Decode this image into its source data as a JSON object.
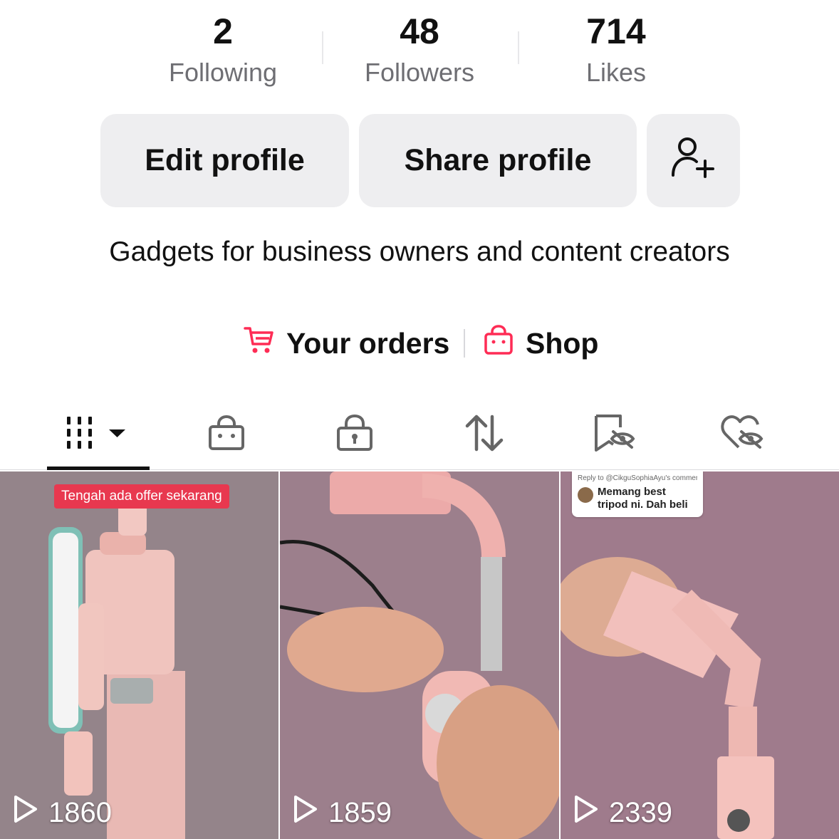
{
  "stats": [
    {
      "value": "2",
      "label": "Following"
    },
    {
      "value": "48",
      "label": "Followers"
    },
    {
      "value": "714",
      "label": "Likes"
    }
  ],
  "actions": {
    "edit_label": "Edit profile",
    "share_label": "Share profile",
    "add_friend_icon": "person-plus-icon"
  },
  "bio": "Gadgets for business owners and content creators",
  "links": {
    "orders_label": "Your orders",
    "orders_icon": "cart-icon",
    "shop_label": "Shop",
    "shop_icon": "shopping-bag-icon",
    "accent_color": "#fe2c55"
  },
  "tabs": [
    {
      "icon": "grid-icon",
      "active": true
    },
    {
      "icon": "shopping-bag-icon",
      "active": false
    },
    {
      "icon": "lock-icon",
      "active": false
    },
    {
      "icon": "repost-icon",
      "active": false
    },
    {
      "icon": "hidden-favorites-icon",
      "active": false
    },
    {
      "icon": "hidden-liked-icon",
      "active": false
    }
  ],
  "videos": [
    {
      "views": "1860",
      "overlay_text": "Tengah ada offer sekarang"
    },
    {
      "views": "1859"
    },
    {
      "views": "2339",
      "comment": {
        "reply_to": "Reply to @CikguSophiaAyu's comment",
        "text": "Memang best tripod ni. Dah beli"
      }
    }
  ]
}
